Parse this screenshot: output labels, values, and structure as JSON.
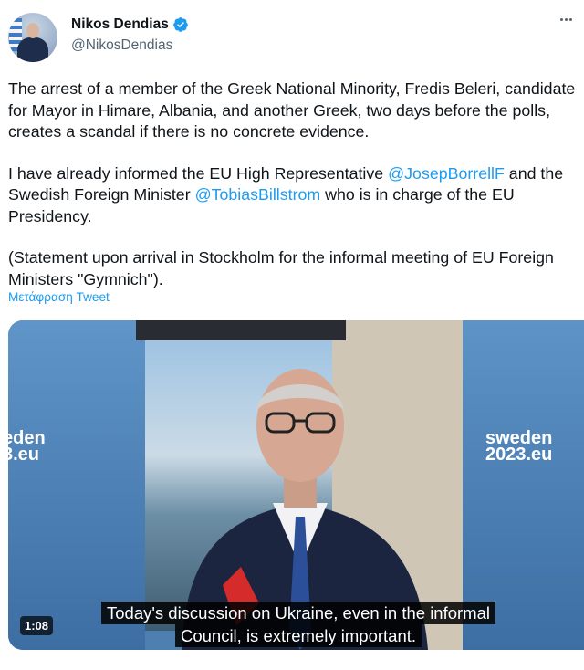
{
  "tweet": {
    "author": {
      "name": "Nikos Dendias",
      "handle": "@NikosDendias",
      "verified_icon": "verified-badge-icon",
      "avatar_icon": "profile-photo"
    },
    "more_icon": "more-options-icon",
    "paragraphs": {
      "p1": "The arrest of a member of the Greek National Minority, Fredis Beleri, candidate for Mayor in Himare, Albania, and another Greek, two days before the polls, creates a scandal if there is no concrete evidence.",
      "p2_before": "I have already informed the EU High Representative ",
      "p2_mention1": "@JosepBorrellF",
      "p2_middle": " and the Swedish Foreign Minister ",
      "p2_mention2": "@TobiasBillstrom",
      "p2_after": " who is in charge of the EU Presidency.",
      "p3": "(Statement upon arrival in Stockholm for the informal meeting of EU Foreign Ministers \"Gymnich\")."
    },
    "translate_link": "Μετάφραση Tweet"
  },
  "video": {
    "duration": "1:08",
    "caption_line1": "Today's discussion on Ukraine, even in the informal",
    "caption_line2": "Council, is extremely important.",
    "backdrop_left": "eden\n3.eu",
    "backdrop_right": "sweden\n2023.eu"
  },
  "colors": {
    "link": "#1d9bf0",
    "verified": "#1d9bf0",
    "text": "#0f1419",
    "secondary": "#536471"
  }
}
